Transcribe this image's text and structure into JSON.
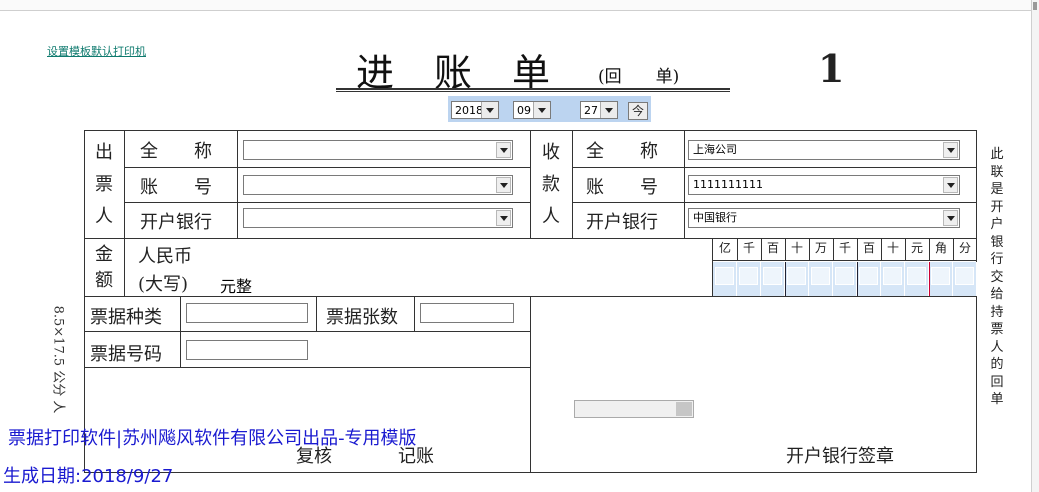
{
  "header": {
    "printer_link": "设置模板默认打印机",
    "title_chars": [
      "进",
      "账",
      "单"
    ],
    "title_sub": "(回　　单)",
    "copy_number": "1"
  },
  "date": {
    "year": "2018",
    "month": "09",
    "day": "27",
    "today_button": "今"
  },
  "drawer": {
    "vertical_label": [
      "出",
      "票",
      "人"
    ],
    "full_name_label": "全　　称",
    "account_label": "账　　号",
    "bank_label": "开户银行",
    "full_name_value": "",
    "account_value": "",
    "bank_value": ""
  },
  "payee": {
    "vertical_label": [
      "收",
      "款",
      "人"
    ],
    "full_name_label": "全　　称",
    "account_label": "账　　号",
    "bank_label": "开户银行",
    "full_name_value": "上海公司",
    "account_value": "1111111111",
    "bank_value": "中国银行"
  },
  "amount": {
    "vertical_label": [
      "金",
      "额"
    ],
    "currency_label": "人民币",
    "uppercase_label": "(大写)",
    "uppercase_value": "元整",
    "digit_headers": [
      "亿",
      "千",
      "百",
      "十",
      "万",
      "千",
      "百",
      "十",
      "元",
      "角",
      "分"
    ]
  },
  "bill": {
    "type_label": "票据种类",
    "count_label": "票据张数",
    "number_label": "票据号码",
    "type_value": "",
    "count_value": "",
    "number_value": ""
  },
  "signoff": {
    "review_label": "复核",
    "bookkeeping_label": "记账",
    "bank_seal_label": "开户银行签章"
  },
  "side_note": [
    "此",
    "联",
    "是",
    "开",
    "户",
    "银",
    "行",
    "交",
    "给",
    "持",
    "票",
    "人",
    "的",
    "回",
    "单"
  ],
  "paper_size": "8.5×17.5 公分 人",
  "footer": {
    "software_line": "票据打印软件|苏州飚风软件有限公司出品-专用模版",
    "generated_line": "生成日期:2018/9/27"
  }
}
